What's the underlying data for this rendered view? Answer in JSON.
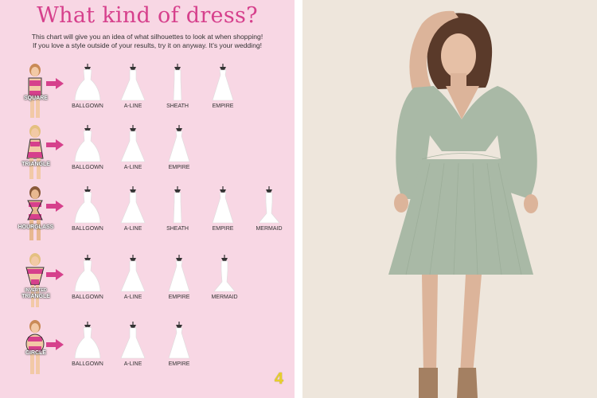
{
  "chart": {
    "title": "What kind of dress?",
    "subtitle_line1": "This chart will give you an idea of what silhouettes to look at when shopping!",
    "subtitle_line2": "If you love a style outside of your results, try it on anyway. It's your wedding!",
    "page_number": "4",
    "rows": [
      {
        "body": "SQUARE",
        "styles": [
          "BALLGOWN",
          "A-LINE",
          "SHEATH",
          "EMPIRE"
        ]
      },
      {
        "body": "TRIANGLE",
        "styles": [
          "BALLGOWN",
          "A-LINE",
          "EMPIRE"
        ]
      },
      {
        "body": "HOURGLASS",
        "styles": [
          "BALLGOWN",
          "A-LINE",
          "SHEATH",
          "EMPIRE",
          "MERMAID"
        ]
      },
      {
        "body_line1": "INVERTED",
        "body_line2": "TRIANGLE",
        "styles": [
          "BALLGOWN",
          "A-LINE",
          "EMPIRE",
          "MERMAID"
        ]
      },
      {
        "body": "CIRCLE",
        "styles": [
          "BALLGOWN",
          "A-LINE",
          "EMPIRE"
        ]
      }
    ]
  },
  "colors": {
    "panel": "#f8d7e4",
    "accent": "#d6408c",
    "page_number": "#e7cf2b",
    "dress_color": "#a9b9a6",
    "photo_background": "#eee6dc"
  }
}
